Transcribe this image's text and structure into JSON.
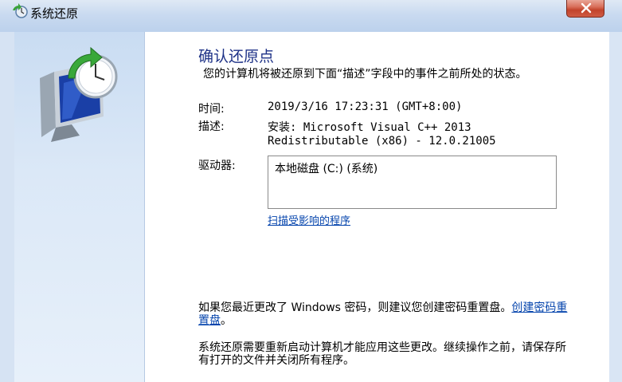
{
  "window": {
    "title": "系统还原",
    "close_label": "X"
  },
  "main": {
    "heading": "确认还原点",
    "subtext": "您的计算机将被还原到下面“描述”字段中的事件之前所处的状态。",
    "time_label": "时间:",
    "time_value": "2019/3/16 17:23:31 (GMT+8:00)",
    "desc_label": "描述:",
    "desc_line1": "安装: Microsoft Visual C++ 2013",
    "desc_line2": "Redistributable (x86) - 12.0.21005",
    "drives_label": "驱动器:",
    "drive_item": "本地磁盘 (C:) (系统)",
    "scan_link": "扫描受影响的程序",
    "password_text": "如果您最近更改了 Windows 密码，则建议您创建密码重置盘。",
    "password_link": "创建密码重置盘",
    "password_end": "。",
    "restart_text": "系统还原需要重新启动计算机才能应用这些更改。继续操作之前，请保存所有打开的文件并关闭所有程序。"
  },
  "colors": {
    "heading": "#1e3287",
    "link": "#0645ad",
    "close": "#c2432b"
  },
  "icons": {
    "title": "system-restore-icon",
    "art": "computer-clock-restore-icon"
  }
}
